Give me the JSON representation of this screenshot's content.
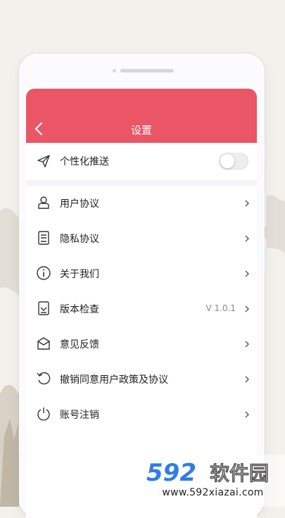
{
  "header": {
    "title": "设置"
  },
  "push_row": {
    "label": "个性化推送",
    "toggle_on": false
  },
  "menu": [
    {
      "label": "用户协议",
      "icon": "user-agreement-icon"
    },
    {
      "label": "隐私协议",
      "icon": "privacy-icon"
    },
    {
      "label": "关于我们",
      "icon": "info-icon"
    },
    {
      "label": "版本检查",
      "icon": "version-icon",
      "value": "V 1.0.1"
    },
    {
      "label": "意见反馈",
      "icon": "feedback-icon"
    },
    {
      "label": "撤销同意用户政策及协议",
      "icon": "revoke-icon"
    },
    {
      "label": "账号注销",
      "icon": "power-icon"
    }
  ],
  "watermark": {
    "logo_digits": "592",
    "logo_text": "软件园",
    "url": "www.592xiazai.com"
  },
  "colors": {
    "header": "#ea5665",
    "watermark_blue": "#2f7ee6"
  }
}
